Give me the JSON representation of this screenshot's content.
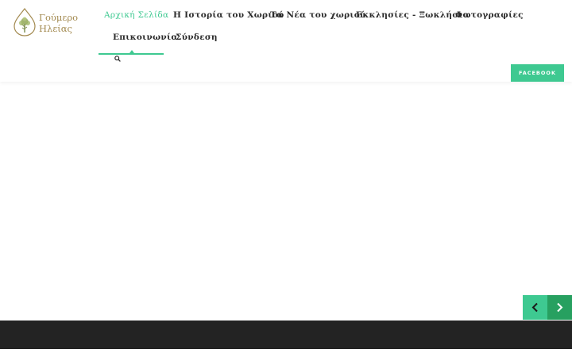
{
  "logo": {
    "line1": "Γούμερο",
    "line2": "Ηλείας",
    "icon": "olive-tree-drop-icon"
  },
  "nav": {
    "items": [
      {
        "label": "Αρχική Σελίδα",
        "active": true
      },
      {
        "label": "Η Ιστορία του Χωριού",
        "active": false
      },
      {
        "label": "Τα Νέα του χωριού",
        "active": false
      },
      {
        "label": "Εκκλησίες - Ξωκλήσια",
        "active": false
      },
      {
        "label": "Φωτογραφίες",
        "active": false
      },
      {
        "label": "Επικοινωνία",
        "active": false
      },
      {
        "label": "Σύνδεση",
        "active": false
      }
    ],
    "search_icon": "search-icon"
  },
  "social": {
    "facebook_label": "FACEBOOK"
  },
  "slider": {
    "prev_icon": "chevron-left-icon",
    "next_icon": "chevron-right-icon"
  },
  "colors": {
    "accent": "#3ec991",
    "logo_gold": "#a38a50",
    "nav_text": "#2b2b2b",
    "footer": "#232323",
    "arrow_bg": "#27a060"
  }
}
